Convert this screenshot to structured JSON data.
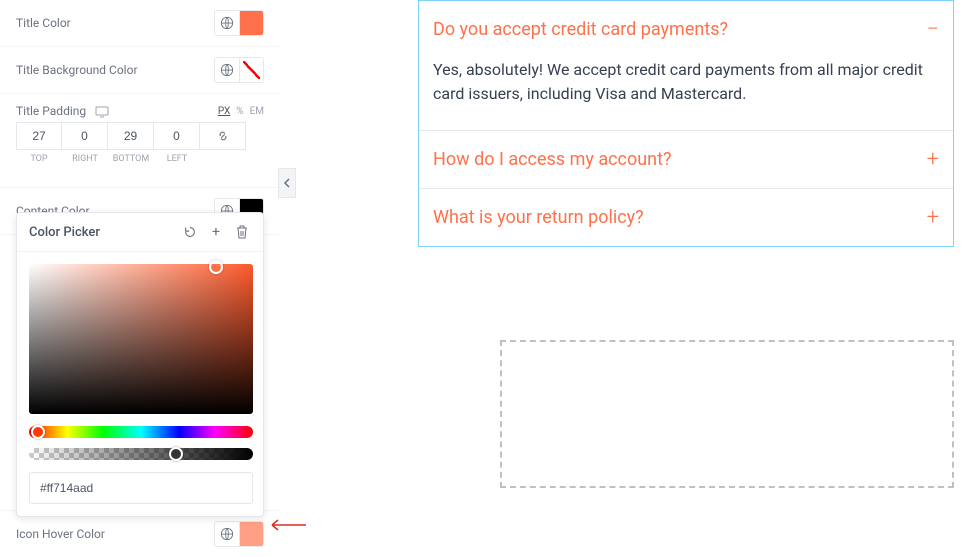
{
  "sidebar": {
    "title_color_label": "Title Color",
    "title_bg_label": "Title Background Color",
    "title_padding_label": "Title Padding",
    "units": [
      "PX",
      "%",
      "EM"
    ],
    "active_unit": "PX",
    "padding": {
      "top": "27",
      "right": "0",
      "bottom": "29",
      "left": "0"
    },
    "padding_labels": {
      "top": "TOP",
      "right": "RIGHT",
      "bottom": "BOTTOM",
      "left": "LEFT"
    },
    "content_color_label": "Content Color",
    "icon_hover_label": "Icon Hover Color"
  },
  "color_picker": {
    "title": "Color Picker",
    "hex": "#ff714aad"
  },
  "accordion": {
    "items": [
      {
        "title": "Do you accept credit card payments?",
        "expanded": true,
        "body": "Yes, absolutely! We accept credit card payments from all major credit card issuers, including Visa and Mastercard."
      },
      {
        "title": "How do I access my account?",
        "expanded": false
      },
      {
        "title": "What is your return policy?",
        "expanded": false
      }
    ]
  },
  "colors": {
    "accent": "#ff714a",
    "hover_swatch": "#ff9f85"
  }
}
